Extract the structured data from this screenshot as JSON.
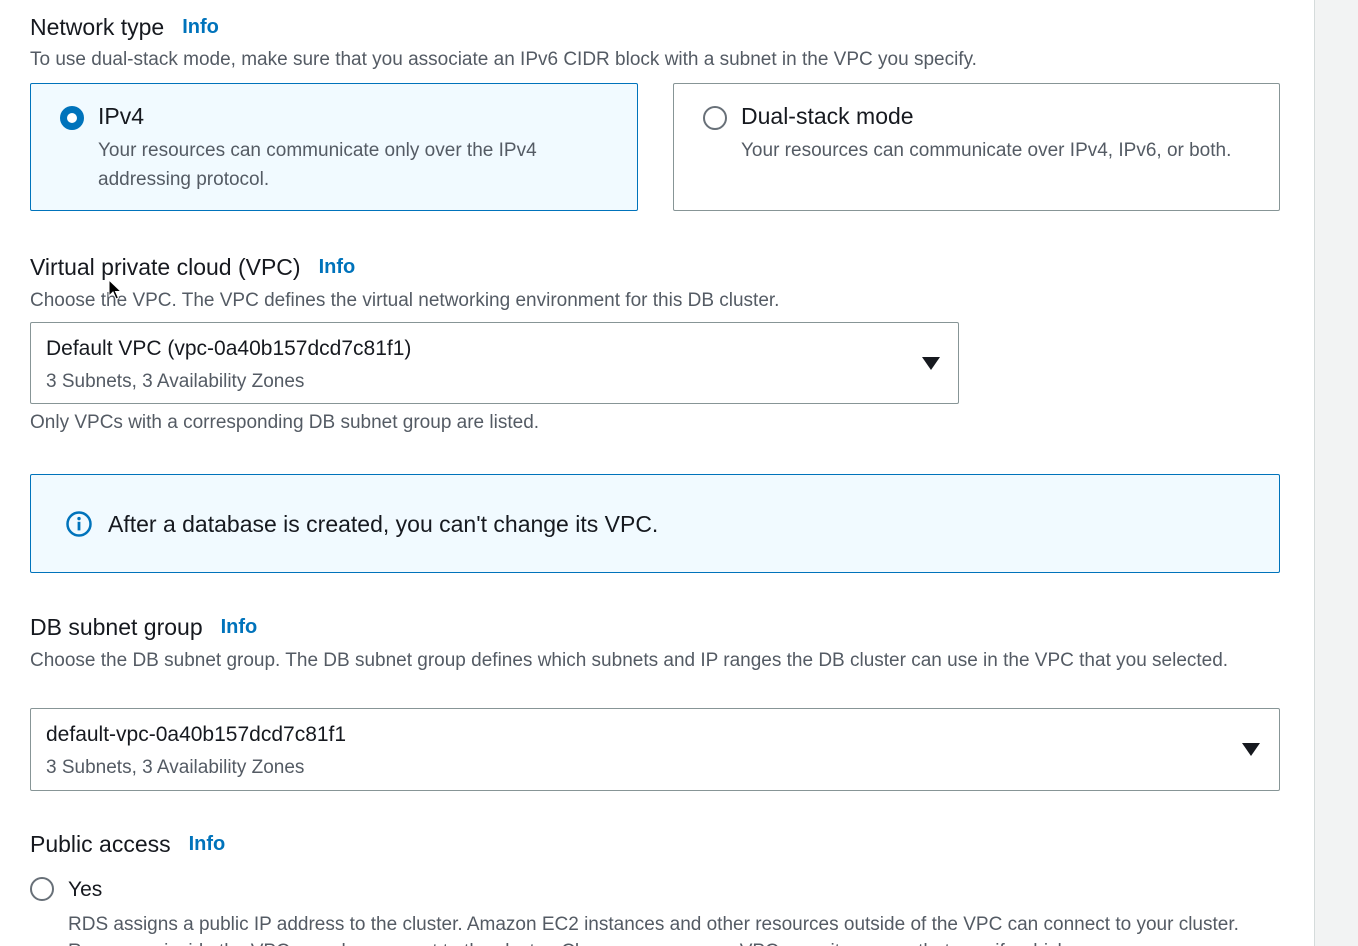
{
  "network_type": {
    "label": "Network type",
    "info": "Info",
    "description": "To use dual-stack mode, make sure that you associate an IPv6 CIDR block with a subnet in the VPC you specify.",
    "options": [
      {
        "title": "IPv4",
        "description": "Your resources can communicate only over the IPv4 addressing protocol.",
        "selected": true
      },
      {
        "title": "Dual-stack mode",
        "description": "Your resources can communicate over IPv4, IPv6, or both.",
        "selected": false
      }
    ]
  },
  "vpc": {
    "label": "Virtual private cloud (VPC)",
    "info": "Info",
    "description": "Choose the VPC. The VPC defines the virtual networking environment for this DB cluster.",
    "selected_value": "Default VPC (vpc-0a40b157dcd7c81f1)",
    "selected_detail": "3 Subnets, 3 Availability Zones",
    "hint": "Only VPCs with a corresponding DB subnet group are listed."
  },
  "alert": {
    "icon": "info-circle-icon",
    "text": "After a database is created, you can't change its VPC."
  },
  "subnet_group": {
    "label": "DB subnet group",
    "info": "Info",
    "description": "Choose the DB subnet group. The DB subnet group defines which subnets and IP ranges the DB cluster can use in the VPC that you selected.",
    "selected_value": "default-vpc-0a40b157dcd7c81f1",
    "selected_detail": "3 Subnets, 3 Availability Zones"
  },
  "public_access": {
    "label": "Public access",
    "info": "Info",
    "option_yes": {
      "label": "Yes",
      "description": "RDS assigns a public IP address to the cluster. Amazon EC2 instances and other resources outside of the VPC can connect to your cluster. Resources inside the VPC can also connect to the cluster. Choose one or more VPC security groups that specify which",
      "selected": false
    }
  },
  "colors": {
    "accent": "#0073bb",
    "selected_bg": "#f1faff",
    "border": "#879596",
    "text": "#16191f",
    "secondary_text": "#545b64"
  }
}
